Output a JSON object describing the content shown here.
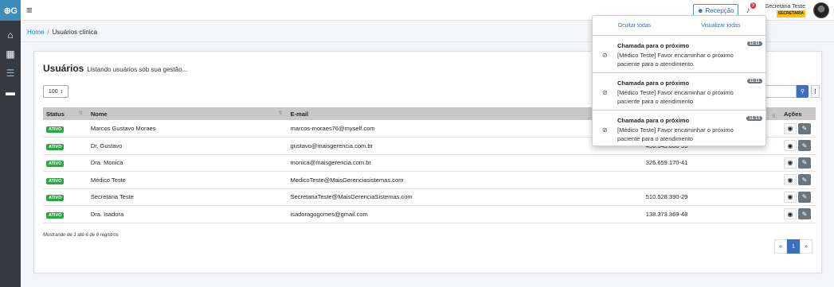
{
  "brand": "⊕G",
  "sidebar": {
    "items": [
      {
        "icon": "home-icon",
        "glyph": "⌂"
      },
      {
        "icon": "calendar-icon",
        "glyph": "▦"
      },
      {
        "icon": "list-icon",
        "glyph": "☰"
      },
      {
        "icon": "archive-icon",
        "glyph": "▬"
      }
    ]
  },
  "navbar": {
    "menu_glyph": "≡",
    "recepcao_icon": "☻",
    "recepcao_label": "Recepção",
    "bell_glyph": "♪",
    "notif_count": "3",
    "user_name": "Secretária Teste",
    "user_role": "SECRETARIA"
  },
  "breadcrumb": {
    "home": "Home",
    "sep": "/",
    "current": "Usuários clínica"
  },
  "card": {
    "title": "Usuários",
    "subtitle": "Listando usuários sob sua gestão..."
  },
  "table_controls": {
    "page_size": "100",
    "page_size_arrow": "↕",
    "search_glyph": "⚲",
    "more_glyph": "⋮"
  },
  "table": {
    "headers": {
      "status": "Status",
      "nome": "Nome",
      "email": "E-mail",
      "acoes": "Ações",
      "sort_glyph": "⇅"
    },
    "rows": [
      {
        "status": "ATIVO",
        "nome": "Marcos Gustavo Moraes",
        "email": "marcos-moraes76@myself.com",
        "cpf": ""
      },
      {
        "status": "ATIVO",
        "nome": "Dr. Gustavo",
        "email": "gustavo@maisgerencia.com.br",
        "cpf": "450.549.880-59"
      },
      {
        "status": "ATIVO",
        "nome": "Dra. Monica",
        "email": "monica@maisgerencia.com.br",
        "cpf": "326.659.170-41"
      },
      {
        "status": "ATIVO",
        "nome": "Médico Teste",
        "email": "MedicoTeste@MaisGerenciasistemas.com",
        "cpf": ""
      },
      {
        "status": "ATIVO",
        "nome": "Secretária Teste",
        "email": "SecretariaTeste@MaisGerenciaSistemas.com",
        "cpf": "510.528.390-29"
      },
      {
        "status": "ATIVO",
        "nome": "Dra. Isadora",
        "email": "isadoragogomes@gmail.com",
        "cpf": "138.373.369-48"
      }
    ],
    "view_glyph": "◉",
    "edit_glyph": "✎"
  },
  "footer": {
    "info": "Mostrando de 1 até 6 de 6 registros",
    "pager": {
      "prev": "«",
      "current": "1",
      "next": "»"
    }
  },
  "notifications": {
    "hide_all": "Ocultar todas",
    "view_all": "Visualizar todas",
    "eye_glyph": "⊘",
    "items": [
      {
        "title": "Chamada para o próximo",
        "time": "11:11",
        "text": "[Médico Teste] Favor encaminhar o próximo paciente para o atendimento"
      },
      {
        "title": "Chamada para o próximo",
        "time": "11:11",
        "text": "[Médico Teste] Favor encaminhar o próximo paciente para o atendimento"
      },
      {
        "title": "Chamada para o próximo",
        "time": "11:13",
        "text": "[Médico Teste] Favor encaminhar o próximo paciente para o atendimento"
      }
    ]
  }
}
